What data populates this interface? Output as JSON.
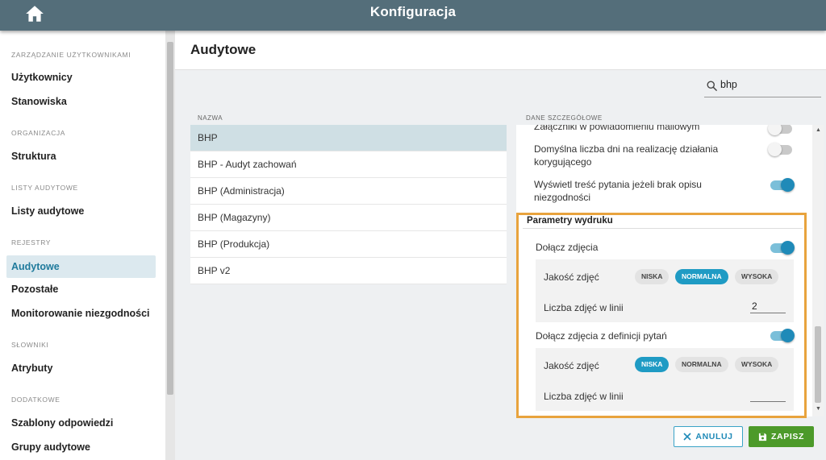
{
  "header": {
    "title": "Konfiguracja"
  },
  "sidebar": {
    "sections": [
      {
        "label": "ZARZĄDZANIE UŻYTKOWNIKAMI",
        "items": [
          "Użytkownicy",
          "Stanowiska"
        ]
      },
      {
        "label": "ORGANIZACJA",
        "items": [
          "Struktura"
        ]
      },
      {
        "label": "LISTY AUDYTOWE",
        "items": [
          "Listy audytowe"
        ]
      },
      {
        "label": "REJESTRY",
        "items": [
          "Audytowe",
          "Pozostałe",
          "Monitorowanie niezgodności"
        ]
      },
      {
        "label": "SŁOWNIKI",
        "items": [
          "Atrybuty"
        ]
      },
      {
        "label": "DODATKOWE",
        "items": [
          "Szablony odpowiedzi",
          "Grupy audytowe"
        ]
      }
    ],
    "active_item": "Audytowe"
  },
  "main": {
    "title": "Audytowe",
    "search": {
      "value": "bhp"
    },
    "list": {
      "column_label": "NAZWA",
      "rows": [
        "BHP",
        "BHP - Audyt zachowań",
        "BHP (Administracja)",
        "BHP (Magazyny)",
        "BHP (Produkcja)",
        "BHP v2"
      ],
      "selected": "BHP"
    },
    "details": {
      "column_label": "DANE SZCZEGÓŁOWE",
      "settings": [
        {
          "label": "Załączniki w powiadomieniu mailowym",
          "enabled": false
        },
        {
          "label": "Domyślna liczba dni na realizację działania korygującego",
          "enabled": false
        },
        {
          "label": "Wyświetl treść pytania jeżeli brak opisu niezgodności",
          "enabled": true
        }
      ],
      "print_params": {
        "title": "Parametry wydruku",
        "groups": [
          {
            "label": "Dołącz zdjęcia",
            "enabled": true,
            "quality_label": "Jakość zdjęć",
            "quality_options": [
              "NISKA",
              "NORMALNA",
              "WYSOKA"
            ],
            "quality_selected": "NORMALNA",
            "per_line_label": "Liczba zdjęć w linii",
            "per_line_value": "2"
          },
          {
            "label": "Dołącz zdjęcia z definicji pytań",
            "enabled": true,
            "quality_label": "Jakość zdjęć",
            "quality_options": [
              "NISKA",
              "NORMALNA",
              "WYSOKA"
            ],
            "quality_selected": "NISKA",
            "per_line_label": "Liczba zdjęć w linii",
            "per_line_value": ""
          }
        ]
      }
    },
    "actions": {
      "cancel": "ANULUJ",
      "save": "ZAPISZ"
    }
  },
  "colors": {
    "topbar": "#546e7a",
    "accent": "#1f8ab8",
    "save": "#4c9a2a",
    "highlight_border": "#e8a33d"
  }
}
